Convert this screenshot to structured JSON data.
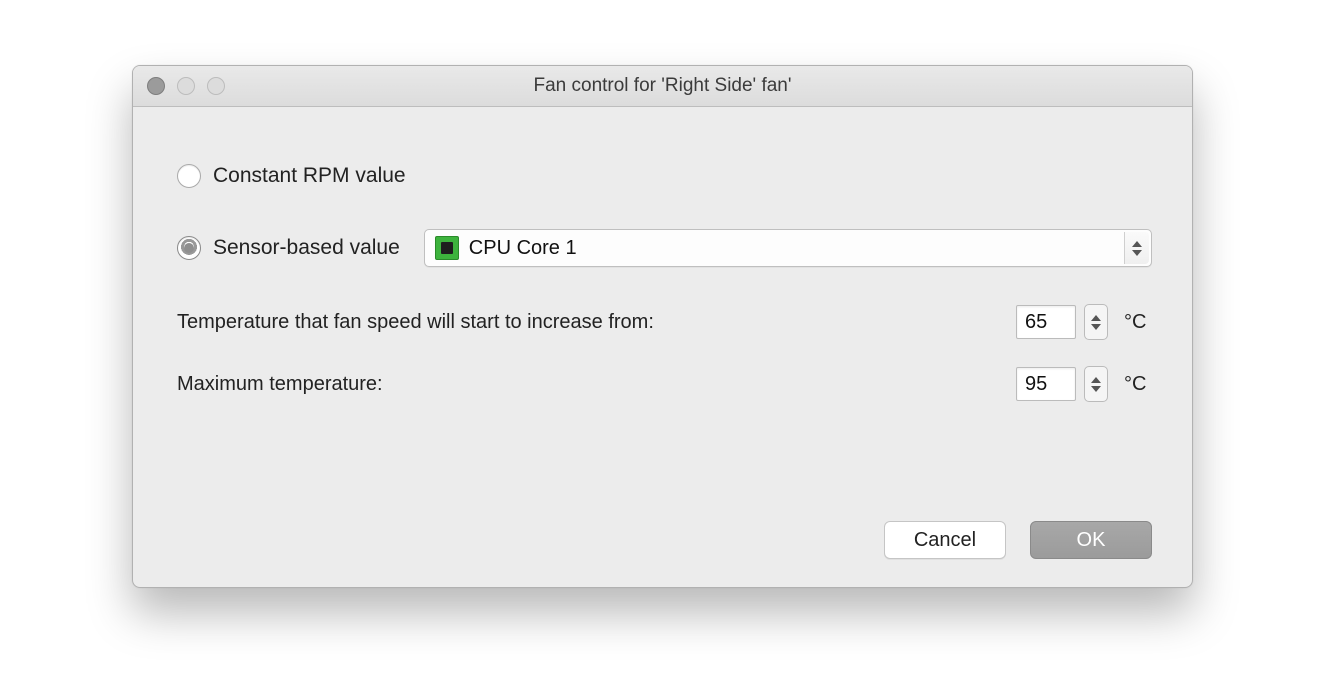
{
  "window": {
    "title": "Fan control for 'Right Side' fan'"
  },
  "options": {
    "constant_rpm": {
      "label": "Constant RPM value",
      "selected": false
    },
    "sensor_based": {
      "label": "Sensor-based value",
      "selected": true
    }
  },
  "sensor": {
    "icon": "chip-icon",
    "selected": "CPU Core 1"
  },
  "settings": {
    "start_increase": {
      "label": "Temperature that fan speed will start to increase from:",
      "value": "65",
      "unit": "°C"
    },
    "max_temp": {
      "label": "Maximum temperature:",
      "value": "95",
      "unit": "°C"
    }
  },
  "buttons": {
    "cancel": "Cancel",
    "ok": "OK"
  }
}
